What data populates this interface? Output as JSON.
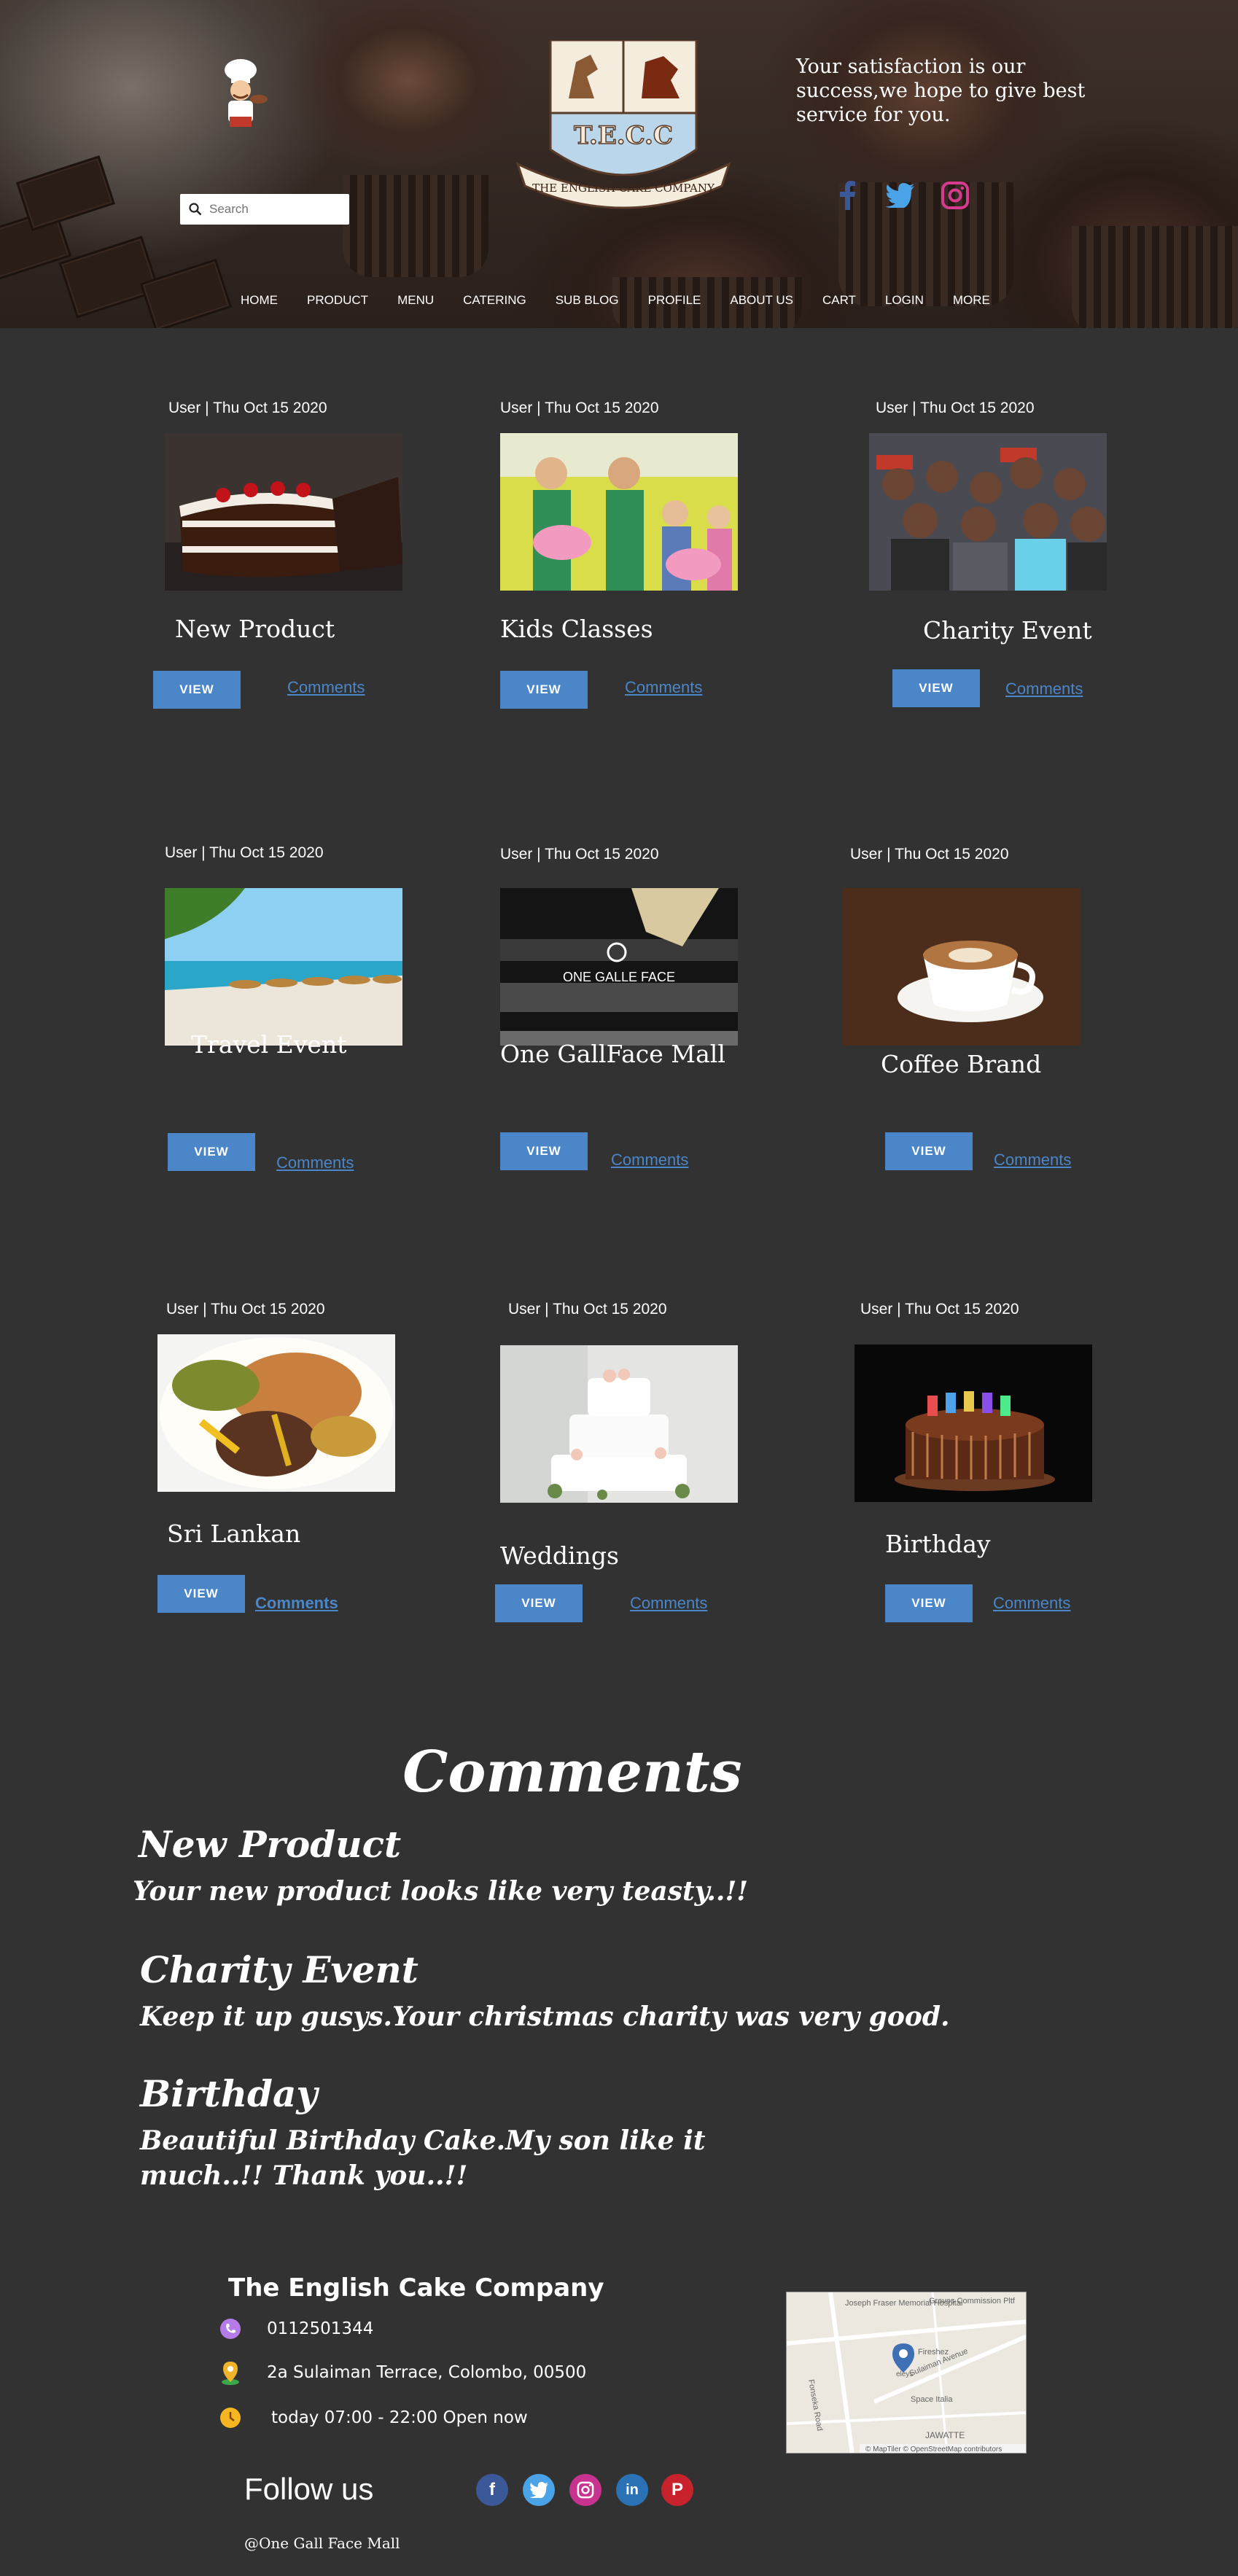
{
  "header": {
    "tagline": "Your satisfaction is our success,we hope to give best service for you.",
    "search": {
      "placeholder": "Search"
    },
    "logo": {
      "letters": "T.E.C.C",
      "banner": "THE ENGLISH CAKE COMPANY"
    },
    "social": [
      "facebook-icon",
      "twitter-icon",
      "instagram-icon"
    ],
    "nav": [
      "HOME",
      "PRODUCT",
      "MENU",
      "CATERING",
      "SUB BLOG",
      "PROFILE",
      "ABOUT US",
      "CART",
      "LOGIN",
      "MORE"
    ]
  },
  "posts": [
    {
      "meta": "User | Thu Oct 15 2020",
      "title": "New Product",
      "view": "VIEW",
      "comments": "Comments",
      "image": "chocolate-cake"
    },
    {
      "meta": "User | Thu Oct 15 2020",
      "title": "Kids Classes",
      "view": "VIEW",
      "comments": "Comments",
      "image": "kids-class"
    },
    {
      "meta": "User | Thu Oct 15 2020",
      "title": "Charity Event",
      "view": "VIEW",
      "comments": "Comments",
      "image": "charity-group"
    },
    {
      "meta": "User | Thu Oct 15 2020",
      "title": "Travel Event",
      "view": "VIEW",
      "comments": "Comments",
      "image": "beach"
    },
    {
      "meta": "User | Thu Oct 15 2020",
      "title": "One GallFace Mall",
      "view": "VIEW",
      "comments": "Comments",
      "image": "mall",
      "image_text": "ONE GALLE FACE"
    },
    {
      "meta": "User | Thu Oct 15 2020",
      "title": "Coffee Brand",
      "view": "VIEW",
      "comments": "Comments",
      "image": "coffee"
    },
    {
      "meta": "User | Thu Oct 15 2020",
      "title": "Sri Lankan",
      "view": "VIEW",
      "comments": "Comments",
      "image": "rice-curry"
    },
    {
      "meta": "User | Thu Oct 15 2020",
      "title": "Weddings",
      "view": "VIEW",
      "comments": "Comments",
      "image": "wedding-cake"
    },
    {
      "meta": "User | Thu Oct 15 2020",
      "title": "Birthday",
      "view": "VIEW",
      "comments": "Comments",
      "image": "birthday-cake"
    }
  ],
  "comments_section": {
    "heading": "Comments",
    "items": [
      {
        "title": "New Product",
        "text": "Your new product looks like very teasty..!!"
      },
      {
        "title": "Charity Event",
        "text": "Keep it up gusys.Your christmas charity was very good."
      },
      {
        "title": "Birthday",
        "text": "Beautiful Birthday Cake.My son like it much..!! Thank you..!!"
      }
    ]
  },
  "footer": {
    "company": "The English Cake Company",
    "phone": "0112501344",
    "address": "2a Sulaiman Terrace, Colombo, 00500",
    "hours": "today 07:00 - 22:00 Open now",
    "follow_label": "Follow us",
    "handle": "@One Gall Face Mall",
    "map": {
      "labels": [
        "Joseph Fraser Memorial Hospital",
        "Graves Commission Pltf",
        "Fonseka Road",
        "Sulaiman Avenue",
        "Fireshez",
        "eleys",
        "Space Italia",
        "JAWATTE"
      ],
      "attribution": "© MapTiler © OpenStreetMap contributors"
    },
    "social": [
      "facebook-icon",
      "twitter-icon",
      "instagram-icon",
      "linkedin-icon",
      "pinterest-icon"
    ]
  },
  "colors": {
    "background": "#323232",
    "accent": "#4a86c8",
    "text": "#ffffff"
  }
}
